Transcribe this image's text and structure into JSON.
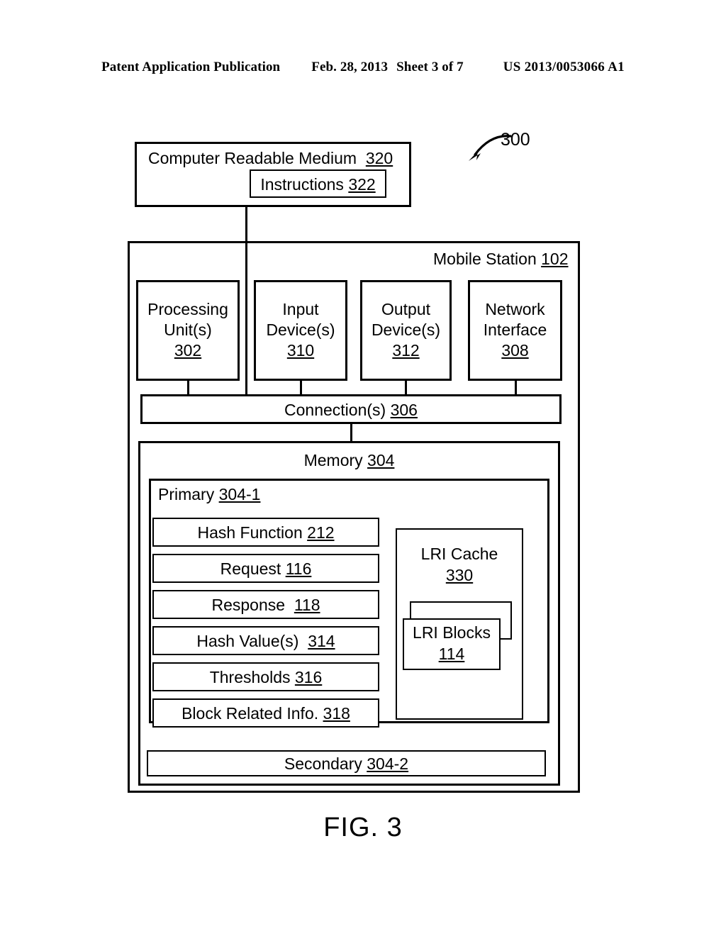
{
  "header": {
    "publication": "Patent Application Publication",
    "date": "Feb. 28, 2013",
    "sheet": "Sheet 3 of 7",
    "patent_number": "US 2013/0053066 A1"
  },
  "figure": {
    "caption": "FIG. 3",
    "callout_label": "300",
    "callout_icon": "curved-leader-arrow-icon"
  },
  "crm": {
    "title": "Computer Readable Medium",
    "ref": "320",
    "instructions": {
      "label": "Instructions",
      "ref": "322"
    }
  },
  "mobile_station": {
    "title": "Mobile Station",
    "ref": "102",
    "devices": [
      {
        "line1": "Processing",
        "line2": "Unit(s)",
        "ref": "302"
      },
      {
        "line1": "Input",
        "line2": "Device(s)",
        "ref": "310"
      },
      {
        "line1": "Output",
        "line2": "Device(s)",
        "ref": "312"
      },
      {
        "line1": "Network",
        "line2": "Interface",
        "ref": "308"
      }
    ],
    "connections": {
      "label": "Connection(s)",
      "ref": "306"
    },
    "memory": {
      "label": "Memory",
      "ref": "304",
      "primary": {
        "label": "Primary",
        "ref": "304-1",
        "items": [
          {
            "label": "Hash Function",
            "ref": "212"
          },
          {
            "label": "Request",
            "ref": "116"
          },
          {
            "label": "Response",
            "ref": "118"
          },
          {
            "label": "Hash Value(s)",
            "ref": "314"
          },
          {
            "label": "Thresholds",
            "ref": "316"
          },
          {
            "label": "Block Related Info.",
            "ref": "318"
          }
        ],
        "lri_cache": {
          "label": "LRI Cache",
          "ref": "330",
          "blocks": {
            "label": "LRI Blocks",
            "ref": "114"
          }
        }
      },
      "secondary": {
        "label": "Secondary",
        "ref": "304-2"
      }
    }
  },
  "colors": {
    "ink": "#000000",
    "paper": "#ffffff"
  }
}
